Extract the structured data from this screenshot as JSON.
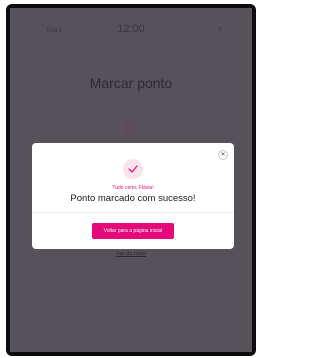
{
  "status_bar": {
    "left_label": "Tela 1",
    "time": "12:00",
    "right_label": "≡"
  },
  "page": {
    "title": "Marcar ponto",
    "exit_link": "Sair da conta"
  },
  "modal": {
    "subtitle": "Tudo certo, Flávia!",
    "title": "Ponto marcado com sucesso!",
    "cta_label": "Voltar para a página inicial",
    "close_symbol": "✕"
  },
  "colors": {
    "accent": "#e5097a",
    "overlay": "#575159",
    "success_bg": "#fbe3ee"
  }
}
